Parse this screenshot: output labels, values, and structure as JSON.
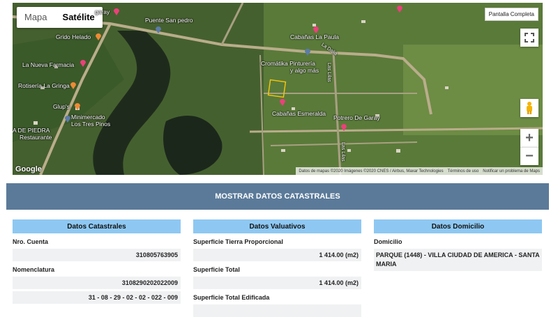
{
  "map": {
    "maptype": {
      "map_label": "Mapa",
      "satellite_label": "Satélite"
    },
    "fullscreen_label": "Pantalla Completa",
    "labels": {
      "garay": "garay",
      "puente": "Puente San pedro",
      "grido": "Grido Helado",
      "cabanas_paula": "Cabañas La Paula",
      "nueva_farmacia": "La Nueva Farmacia",
      "cromatika_1": "Cromátika Pinturería",
      "cromatika_2": "y algo más",
      "rotiseria": "Rotisería La Gringa",
      "glups": "Glup's",
      "minimercado_1": "Minimercado",
      "minimercado_2": "Los Tres Pinos",
      "cabanas_esmeralda": "Cabañas Esmeralda",
      "potrero": "Potrero De Garay",
      "piedra_1": "A DE PIEDRA",
      "piedra_2": "Restaurante",
      "las_lilas_1": "Las Lilas",
      "las_lilas_2": "Las Lilas",
      "la_dalia": "La Dalia"
    },
    "google": "Google",
    "attribution": {
      "data": "Datos de mapas ©2020 Imágenes ©2020 CNES / Airbus, Maxar Technologies",
      "terms": "Términos de uso",
      "report": "Notificar un problema de Maps"
    },
    "zoom_in": "+",
    "zoom_out": "−"
  },
  "catastro_button": "MOSTRAR DATOS CATASTRALES",
  "panels": {
    "catastrales": {
      "title": "Datos Catastrales",
      "cuenta_label": "Nro. Cuenta",
      "cuenta_value": "310805763905",
      "nomenclatura_label": "Nomenclatura",
      "nomenclatura_value": "3108290202022009",
      "nomenclatura_formatted": "31 - 08 - 29 - 02 - 02 - 022 - 009"
    },
    "valuativos": {
      "title": "Datos Valuativos",
      "sup_tierra_label": "Superficie Tierra Proporcional",
      "sup_tierra_value": "1 414.00 (m2)",
      "sup_total_label": "Superficie Total",
      "sup_total_value": "1 414.00 (m2)",
      "sup_edificada_label": "Superficie Total Edificada"
    },
    "domicilio": {
      "title": "Datos Domicilio",
      "domicilio_label": "Domicilio",
      "domicilio_value": "PARQUE (1448) - VILLA CIUDAD DE AMERICA - SANTA MARIA"
    }
  }
}
